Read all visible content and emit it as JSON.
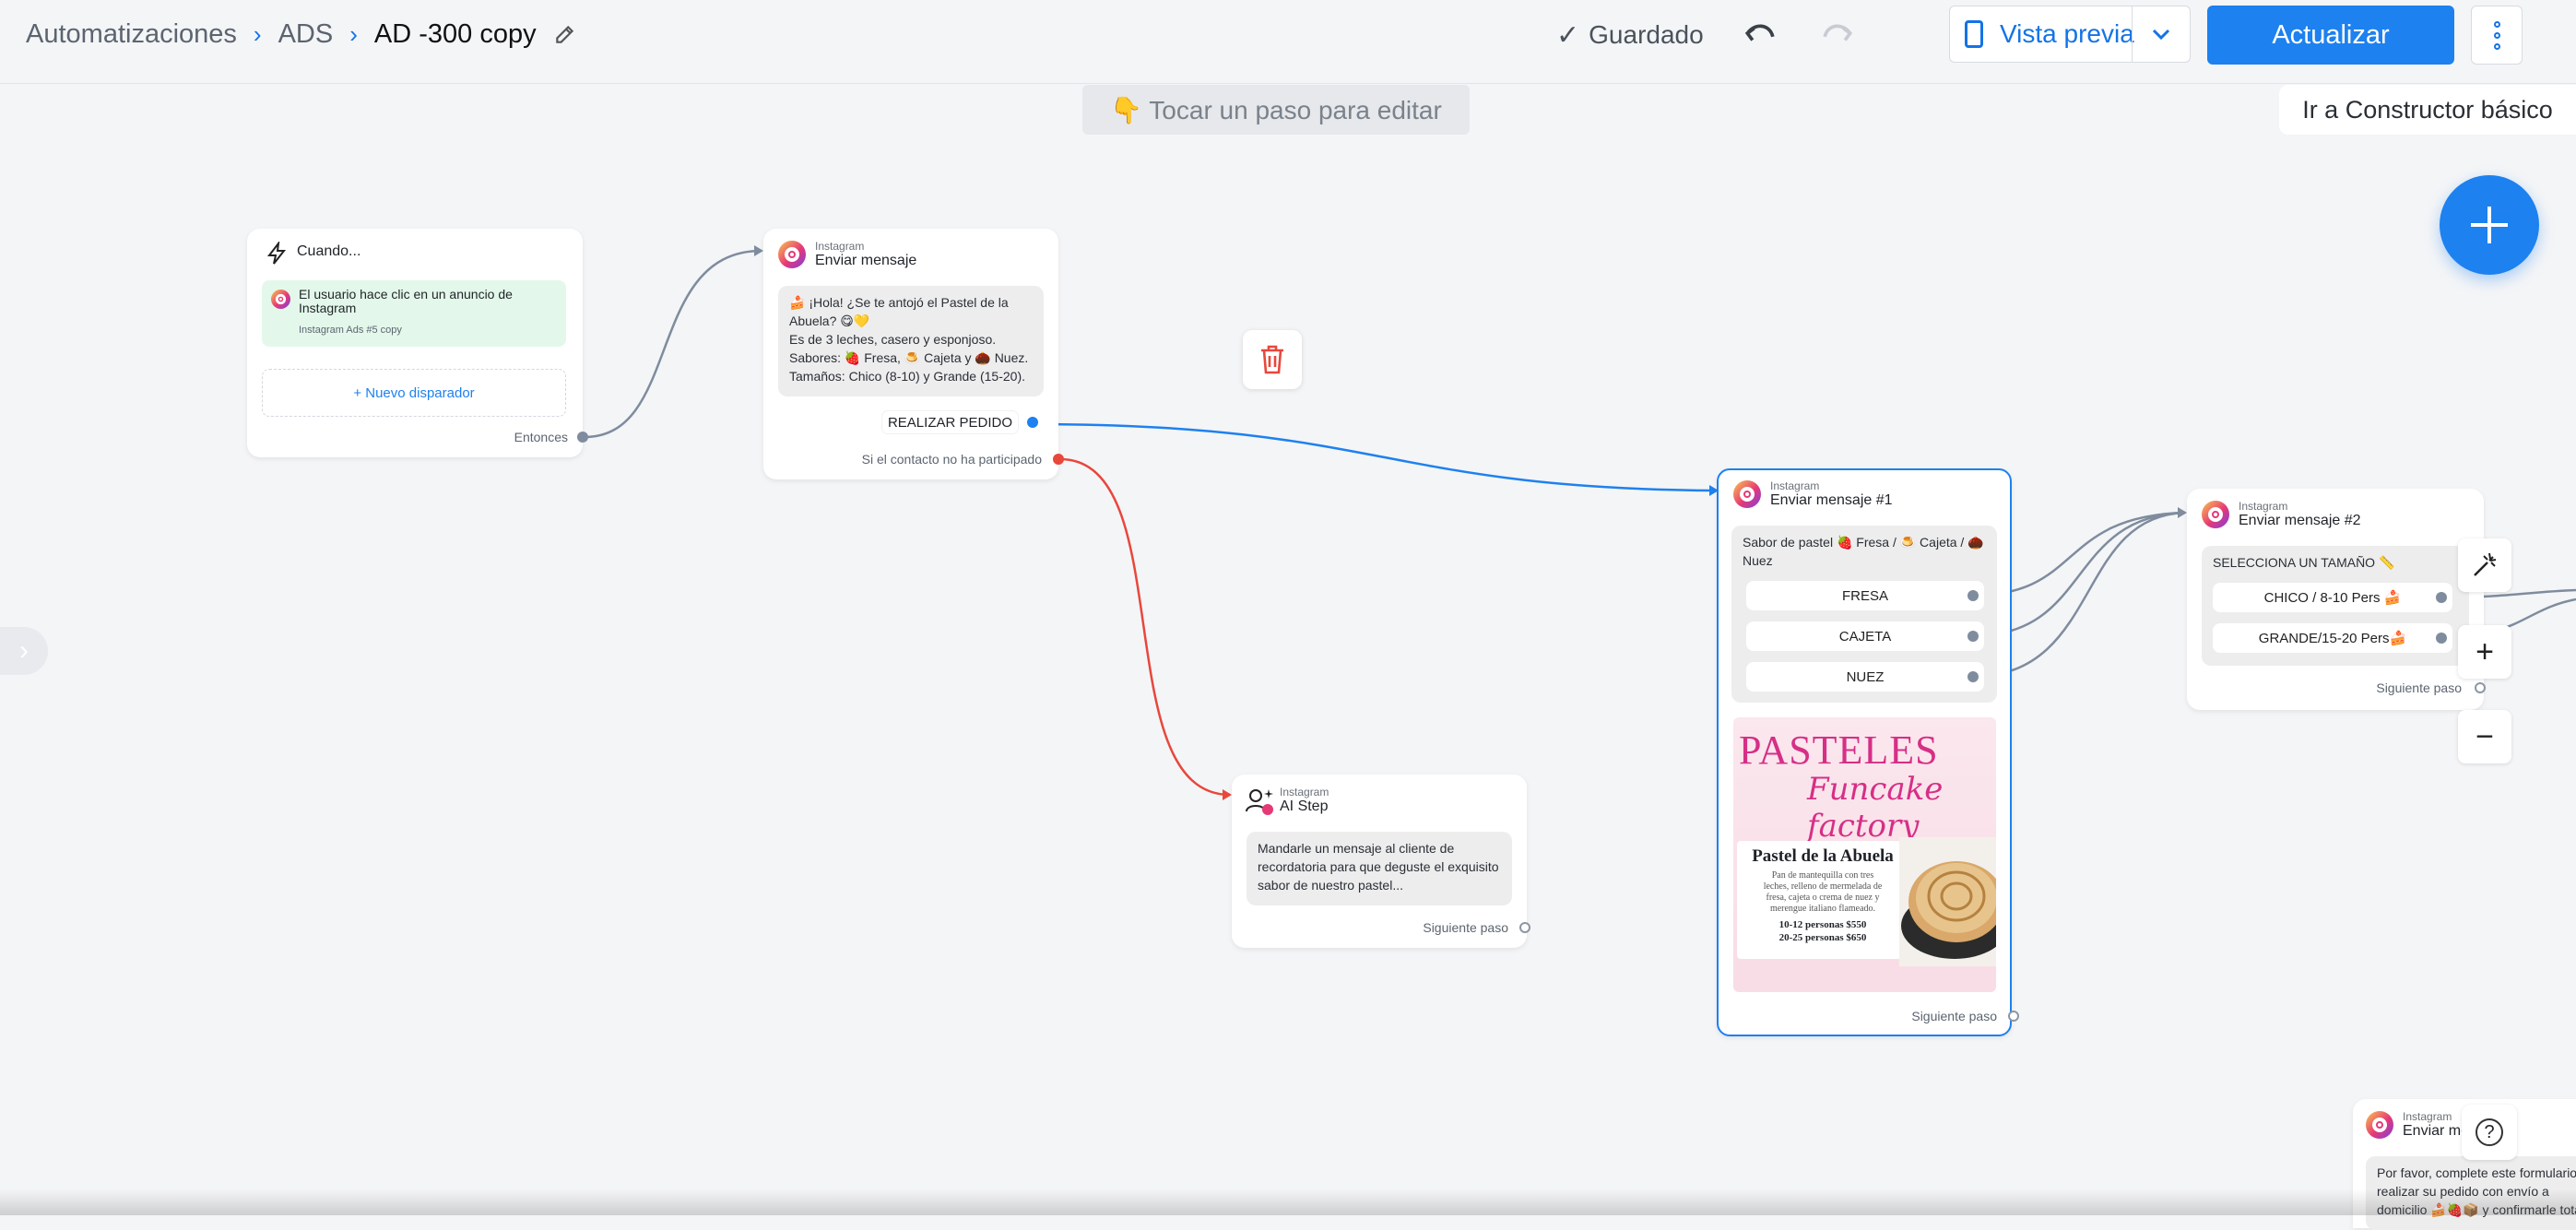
{
  "breadcrumb": {
    "items": [
      "Automatizaciones",
      "ADS"
    ],
    "current": "AD -300 copy"
  },
  "toolbar": {
    "saved_label": "Guardado",
    "preview_label": "Vista previa",
    "update_label": "Actualizar"
  },
  "canvas": {
    "hint": "👇 Tocar un paso para editar",
    "basic_builder_label": "Ir a Constructor básico"
  },
  "trigger_card": {
    "title": "Cuando...",
    "trigger_text": "El usuario hace clic en un anuncio de Instagram",
    "trigger_sub": "Instagram Ads #5 copy",
    "new_trigger": "+ Nuevo disparador",
    "then_label": "Entonces"
  },
  "send_message_card": {
    "platform": "Instagram",
    "title": "Enviar mensaje",
    "lines": [
      "🍰 ¡Hola! ¿Se te antojó el Pastel de la",
      "Abuela? 😋💛",
      "Es de 3 leches, casero y esponjoso.",
      "Sabores: 🍓 Fresa, 🍮 Cajeta y 🌰 Nuez.",
      "Tamaños: Chico (8-10) y Grande (15-20)."
    ],
    "button": "REALIZAR PEDIDO",
    "no_reply": "Si el contacto no ha participado"
  },
  "ai_step_card": {
    "platform": "Instagram",
    "title": "AI Step",
    "lines": [
      "Mandarle un mensaje al cliente de",
      "recordatoria para que deguste el exquisito",
      "sabor de nuestro pastel..."
    ],
    "next": "Siguiente paso"
  },
  "message1_card": {
    "platform": "Instagram",
    "title": "Enviar mensaje #1",
    "prompt_lines": [
      "Sabor de pastel 🍓 Fresa / 🍮 Cajeta / 🌰",
      "Nuez"
    ],
    "buttons": [
      "FRESA",
      "CAJETA",
      "NUEZ"
    ],
    "poster": {
      "title": "PASTELES",
      "brand": "Funcake factory",
      "product": "Pastel de la Abuela",
      "desc": [
        "Pan de mantequilla con tres",
        "leches, relleno de mermelada de",
        "fresa, cajeta o crema de nuez y",
        "merengue italiano flameado."
      ],
      "prices": [
        "10-12 personas $550",
        "20-25 personas $650"
      ]
    },
    "next": "Siguiente paso"
  },
  "message2_card": {
    "platform": "Instagram",
    "title": "Enviar mensaje #2",
    "prompt": "SELECCIONA UN TAMAÑO 📏",
    "buttons": [
      "CHICO / 8-10 Pers 🍰",
      "GRANDE/15-20 Pers🍰"
    ],
    "next": "Siguiente paso"
  },
  "partial_card": {
    "platform": "Instagram",
    "title": "Enviar me",
    "lines": [
      "Por favor, complete este formulario",
      "realizar su pedido con envío a",
      "domicilio 🍰🍓📦 y confirmarle tota"
    ]
  },
  "colors": {
    "accent": "#1d81f0",
    "connector_gray": "#7f8c9e",
    "connector_red": "#e8473c",
    "connector_blue": "#1d81f0",
    "trigger_bg": "#e3f8ea",
    "poster_pink": "#d62f86"
  },
  "icons": [
    "pencil-icon",
    "check-icon",
    "undo-icon",
    "redo-icon",
    "phone-icon",
    "chevron-down-icon",
    "kebab-icon",
    "plus-icon",
    "lightning-icon",
    "instagram-icon",
    "trash-icon",
    "ai-step-icon",
    "magic-wand-icon",
    "minus-icon",
    "help-icon",
    "chevron-right-icon"
  ]
}
